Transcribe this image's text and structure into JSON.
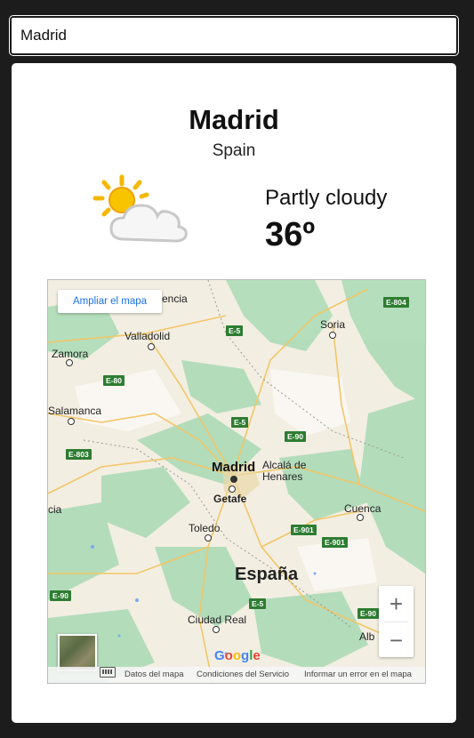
{
  "search": {
    "value": "Madrid"
  },
  "weather": {
    "city": "Madrid",
    "country": "Spain",
    "condition": "Partly cloudy",
    "temperature": "36º",
    "icon": "partly-cloudy-icon"
  },
  "map": {
    "enlarge_label": "Ampliar el mapa",
    "labels": {
      "valencia": "encia",
      "valladolid": "Valladolid",
      "zamora": "Zamora",
      "soria": "Soria",
      "salamanca": "Salamanca",
      "madrid": "Madrid",
      "alcala": "Alcalá de\nHenares",
      "getafe": "Getafe",
      "cia": "cia",
      "cuenca": "Cuenca",
      "toledo": "Toledo",
      "espana": "España",
      "ciudad_real": "Ciudad Real",
      "alb": "Alb"
    },
    "roads": [
      "E-804",
      "E-5",
      "E-80",
      "E-5",
      "E-90",
      "E-803",
      "E-901",
      "E-901",
      "E-90",
      "E-5",
      "E-90"
    ],
    "zoom_in": "+",
    "zoom_out": "−",
    "google": [
      "G",
      "o",
      "o",
      "g",
      "l",
      "e"
    ],
    "footer": {
      "map_data": "Datos del mapa",
      "terms": "Condiciones del Servicio",
      "report": "Informar un error en el mapa"
    }
  }
}
